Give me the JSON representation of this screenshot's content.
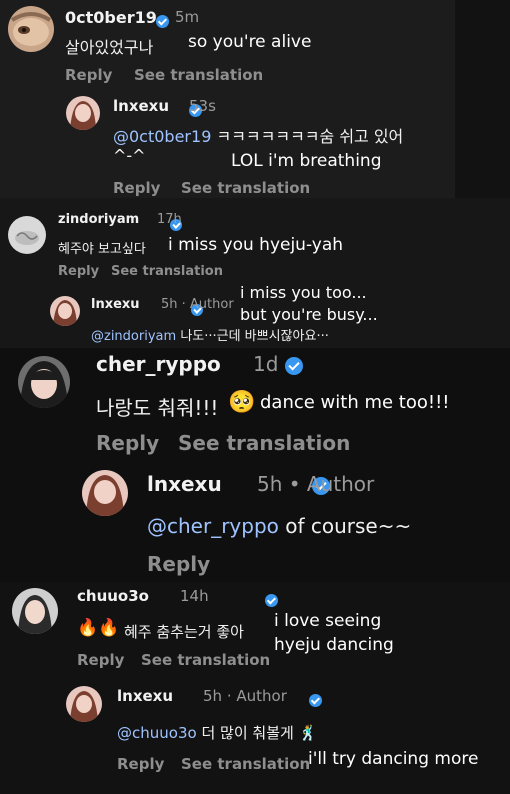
{
  "c1": {
    "user": "0ct0ber19",
    "time": "5m",
    "text": "살아있었구나",
    "translation": "so you're alive",
    "reply": "Reply",
    "see": "See translation"
  },
  "r1": {
    "user": "lnxexu",
    "time": "53s",
    "mention": "@0ct0ber19",
    "text": "ㅋㅋㅋㅋㅋㅋㅋ숨 쉬고 있어",
    "text2": "^-^",
    "translation": "LOL i'm breathing",
    "reply": "Reply",
    "see": "See translation"
  },
  "c2": {
    "user": "zindoriyam",
    "time": "17h",
    "text": "혜주야 보고싶다",
    "translation": "i miss you hyeju-yah",
    "reply": "Reply",
    "see": "See translation"
  },
  "r2": {
    "user": "lnxexu",
    "time": "5h · Author",
    "mention": "@zindoriyam",
    "text": "나도···근데 바쁘시잖아요···",
    "translation1": "i miss you too...",
    "translation2": "but you're busy..."
  },
  "c3": {
    "user": "cher_ryppo",
    "time": "1d",
    "text": "나랑도 춰줘!!!",
    "emoji": "🥺",
    "translation": "dance with me too!!!",
    "reply": "Reply",
    "see": "See translation"
  },
  "r3": {
    "user": "lnxexu",
    "time": "5h • Author",
    "mention": "@cher_ryppo",
    "text": "of course~~",
    "reply": "Reply"
  },
  "c4": {
    "user": "chuuo3o",
    "time": "14h",
    "emoji": "🔥🔥",
    "text": "혜주 춤추는거 좋아",
    "translation1": "i love seeing",
    "translation2": "hyeju dancing",
    "reply": "Reply",
    "see": "See translation"
  },
  "r4": {
    "user": "lnxexu",
    "time": "5h · Author",
    "mention": "@chuuo3o",
    "text": "더 많이 춰볼게",
    "emoji": "🕺",
    "translation": "i'll try dancing more",
    "reply": "Reply",
    "see": "See translation"
  },
  "colors": {
    "verified": "#3897f0",
    "mention": "#9fc3ff",
    "meta": "#8e8e8e"
  }
}
